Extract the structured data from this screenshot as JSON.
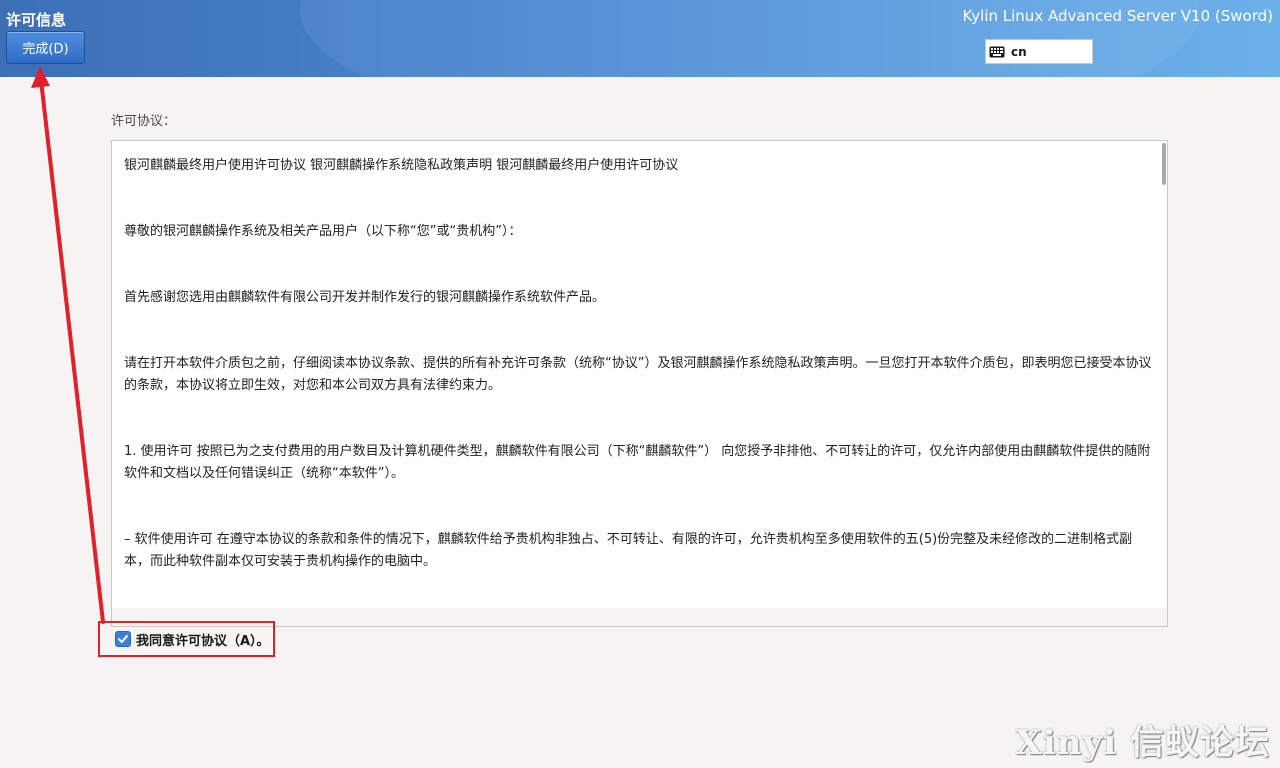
{
  "header": {
    "title": "许可信息",
    "done_label": "完成(D)",
    "product_name": "Kylin Linux Advanced Server V10 (Sword)",
    "keyboard_layout": "cn",
    "keyboard_icon": "keyboard-icon"
  },
  "license": {
    "label": "许可协议：",
    "paragraphs": [
      "银河麒麟最终用户使用许可协议 银河麒麟操作系统隐私政策声明 银河麒麟最终用户使用许可协议",
      " 尊敬的银河麒麟操作系统及相关产品用户（以下称“您”或“贵机构”）：",
      " 首先感谢您选用由麒麟软件有限公司开发并制作发行的银河麒麟操作系统软件产品。",
      " 请在打开本软件介质包之前，仔细阅读本协议条款、提供的所有补充许可条款（统称“协议”）及银河麒麟操作系统隐私政策声明。一旦您打开本软件介质包，即表明您已接受本协议的条款，本协议将立即生效，对您和本公司双方具有法律约束力。",
      " 1. 使用许可 按照已为之支付费用的用户数目及计算机硬件类型，麒麟软件有限公司（下称“麒麟软件”） 向您授予非排他、不可转让的许可，仅允许内部使用由麒麟软件提供的随附软件和文档以及任何错误纠正（统称“本软件”）。",
      " – 软件使用许可 在遵守本协议的条款和条件的情况下，麒麟软件给予贵机构非独占、不可转让、有限的许可，允许贵机构至多使用软件的五(5)份完整及未经修改的二进制格式副本，而此种软件副本仅可安装于贵机构操作的电脑中。"
    ]
  },
  "agree": {
    "label": "我同意许可协议（A）。",
    "checked": true
  },
  "annotation_color": "#e0202a",
  "watermark": "Xinyi 信蚁论坛"
}
